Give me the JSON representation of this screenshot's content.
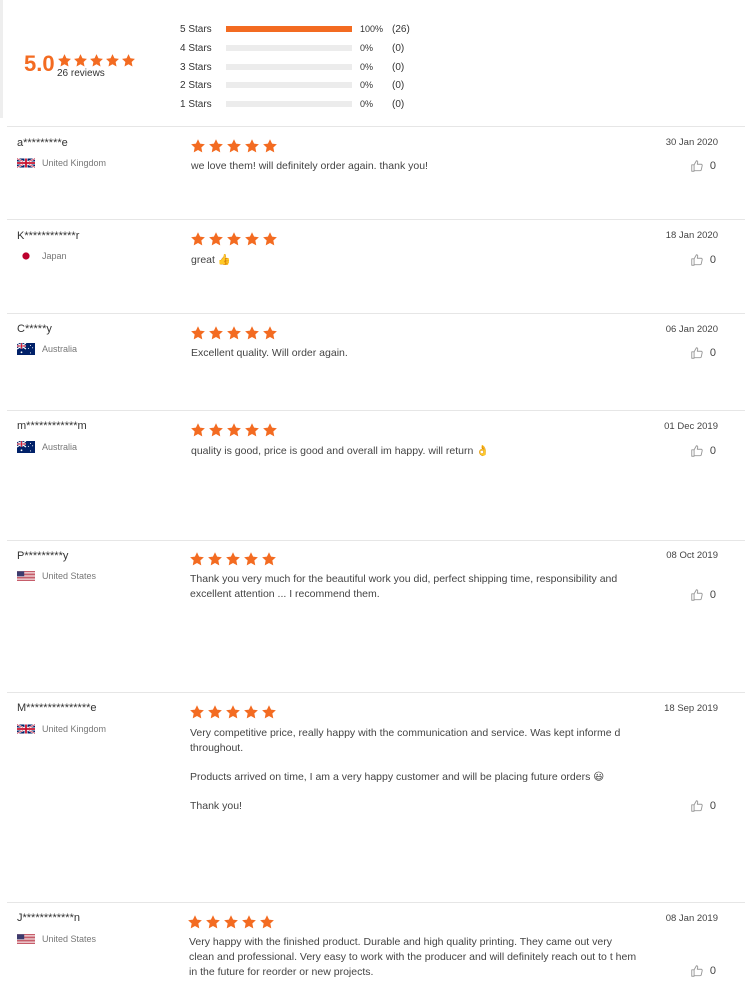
{
  "summary": {
    "average": "5.0",
    "review_count": "26 reviews",
    "histogram": [
      {
        "label": "5 Stars",
        "percent": "100%",
        "count": "(26)",
        "fraction": 1.0
      },
      {
        "label": "4 Stars",
        "percent": "0%",
        "count": "(0)",
        "fraction": 0
      },
      {
        "label": "3 Stars",
        "percent": "0%",
        "count": "(0)",
        "fraction": 0
      },
      {
        "label": "2 Stars",
        "percent": "0%",
        "count": "(0)",
        "fraction": 0
      },
      {
        "label": "1 Stars",
        "percent": "0%",
        "count": "(0)",
        "fraction": 0
      }
    ]
  },
  "colors": {
    "accent": "#f36b21"
  },
  "reviews": [
    {
      "name": "a*********e",
      "country": "United Kingdom",
      "flag": "uk",
      "rating": 5,
      "date": "30 Jan 2020",
      "likes": "0",
      "paragraphs": [
        "we love  them! will definitely order again. thank you!"
      ]
    },
    {
      "name": "K************r",
      "country": "Japan",
      "flag": "jp",
      "rating": 5,
      "date": "18 Jan 2020",
      "likes": "0",
      "paragraphs": [
        "great 👍"
      ]
    },
    {
      "name": "C*****y",
      "country": "Australia",
      "flag": "au",
      "rating": 5,
      "date": "06 Jan 2020",
      "likes": "0",
      "paragraphs": [
        "Excellent quality. Will order again."
      ]
    },
    {
      "name": "m************m",
      "country": "Australia",
      "flag": "au",
      "rating": 5,
      "date": "01 Dec 2019",
      "likes": "0",
      "paragraphs": [
        "quality is good, price is good and overall im happy. will return 👌"
      ]
    },
    {
      "name": "P*********y",
      "country": "United States",
      "flag": "us",
      "rating": 5,
      "date": "08 Oct 2019",
      "likes": "0",
      "paragraphs": [
        "Thank you very much for the beautiful work you did, perfect shipping time, responsibility and excellent attention ... I recommend them."
      ]
    },
    {
      "name": "M***************e",
      "country": "United Kingdom",
      "flag": "uk",
      "rating": 5,
      "date": "18 Sep 2019",
      "likes": "0",
      "paragraphs": [
        "Very competitive price, really happy with the communication and service. Was kept informe d throughout.",
        "Products arrived on time, I am a very happy customer and will be placing future orders 😃",
        "Thank you!"
      ]
    },
    {
      "name": "J************n",
      "country": "United States",
      "flag": "us",
      "rating": 5,
      "date": "08 Jan 2019",
      "likes": "0",
      "paragraphs": [
        "Very happy with the finished product. Durable and high quality printing. They came out very clean and professional. Very easy to work with the producer and will definitely reach out to t hem in the future for reorder or new projects."
      ]
    }
  ]
}
